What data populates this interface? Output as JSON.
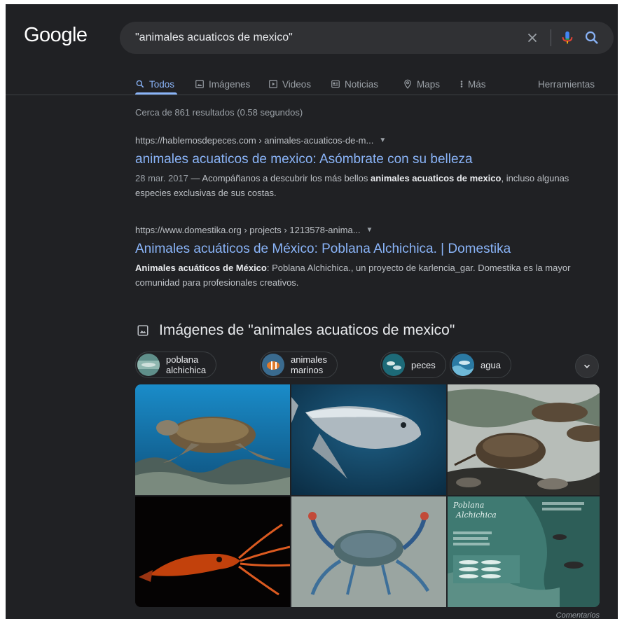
{
  "header": {
    "logo": "Google",
    "search_value": "\"animales acuaticos de mexico\""
  },
  "tabs": [
    {
      "label": "Todos",
      "icon": "search-icon",
      "active": true
    },
    {
      "label": "Imágenes",
      "icon": "image-icon"
    },
    {
      "label": "Videos",
      "icon": "play-icon"
    },
    {
      "label": "Noticias",
      "icon": "news-icon"
    },
    {
      "label": "Maps",
      "icon": "map-pin-icon"
    },
    {
      "label": "Más",
      "icon": "more-vert-icon"
    }
  ],
  "tools_label": "Herramientas",
  "stats": "Cerca de 861 resultados (0.58 segundos)",
  "results": [
    {
      "url": "https://hablemosdepeces.com › animales-acuaticos-de-m...",
      "title": "animales acuaticos de mexico: Asómbrate con su belleza",
      "date": "28 mar. 2017",
      "snippet_pre": " — Acompáñanos a descubrir los más bellos ",
      "snippet_bold": "animales acuaticos de mexico",
      "snippet_post": ", incluso algunas especies exclusivas de sus costas."
    },
    {
      "url": "https://www.domestika.org › projects › 1213578-anima...",
      "title": "Animales acuáticos de México: Poblana Alchichica. | Domestika",
      "snippet_bold": "Animales acuáticos de México",
      "snippet_post": ": Poblana Alchichica., un proyecto de karlencia_gar. Domestika es la mayor comunidad para profesionales creativos."
    }
  ],
  "images_section": {
    "title": "Imágenes de \"animales acuaticos de mexico\"",
    "chips": [
      "poblana alchichica",
      "animales marinos",
      "peces",
      "agua"
    ],
    "image_texts": [
      "Poblana",
      "Alchichica"
    ]
  },
  "feedback": "Comentarios",
  "colors": {
    "background": "#202124",
    "link": "#8ab4f8",
    "text": "#bdc1c6"
  }
}
